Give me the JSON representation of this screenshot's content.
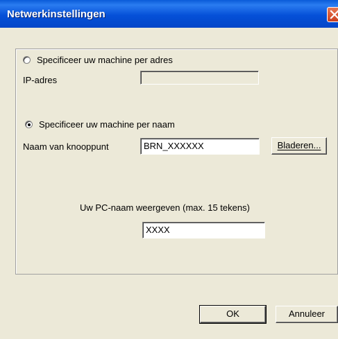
{
  "window": {
    "title": "Netwerkinstellingen",
    "close_icon": "close-icon"
  },
  "options": {
    "by_address": {
      "label": "Specificeer uw machine per adres",
      "selected": false,
      "ip_label": "IP-adres",
      "ip_value": ""
    },
    "by_name": {
      "label": "Specificeer uw machine per naam",
      "selected": true,
      "node_label": "Naam van knooppunt",
      "node_value": "BRN_XXXXXX",
      "browse_label": "Bladeren..."
    }
  },
  "pc_name": {
    "label": "Uw PC-naam weergeven (max. 15 tekens)",
    "value": "XXXX"
  },
  "footer": {
    "ok_label": "OK",
    "cancel_label": "Annuleer"
  },
  "colors": {
    "title_bar": "#0550d8",
    "face": "#ece9d8",
    "close_button": "#d85430"
  }
}
